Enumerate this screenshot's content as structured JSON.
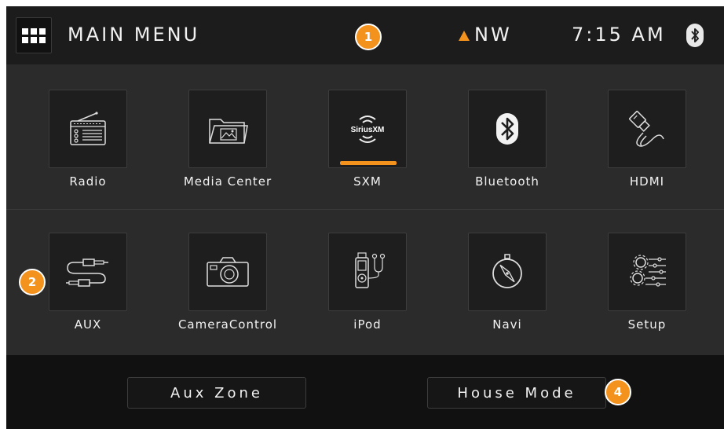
{
  "header": {
    "title": "MAIN MENU",
    "heading": "NW",
    "time": "7:15 AM"
  },
  "sources": [
    {
      "label": "Radio",
      "icon": "radio-icon"
    },
    {
      "label": "Media Center",
      "icon": "folder-photo-icon"
    },
    {
      "label": "SXM",
      "icon": "siriusxm-icon",
      "icon_text": "SiriusXM",
      "active": true
    },
    {
      "label": "Bluetooth",
      "icon": "bluetooth-icon"
    },
    {
      "label": "HDMI",
      "icon": "hdmi-cable-icon"
    },
    {
      "label": "AUX",
      "icon": "aux-cable-icon"
    },
    {
      "label": "CameraControl",
      "icon": "camera-icon"
    },
    {
      "label": "iPod",
      "icon": "ipod-icon"
    },
    {
      "label": "Navi",
      "icon": "compass-icon"
    },
    {
      "label": "Setup",
      "icon": "settings-gears-icon"
    }
  ],
  "footer": {
    "aux_zone": "Aux Zone",
    "house_mode": "House Mode"
  },
  "callouts": [
    "1",
    "2",
    "4"
  ],
  "colors": {
    "accent": "#f4921e",
    "background": "#2b2b2b",
    "header": "#1c1c1c",
    "footer": "#111111"
  }
}
